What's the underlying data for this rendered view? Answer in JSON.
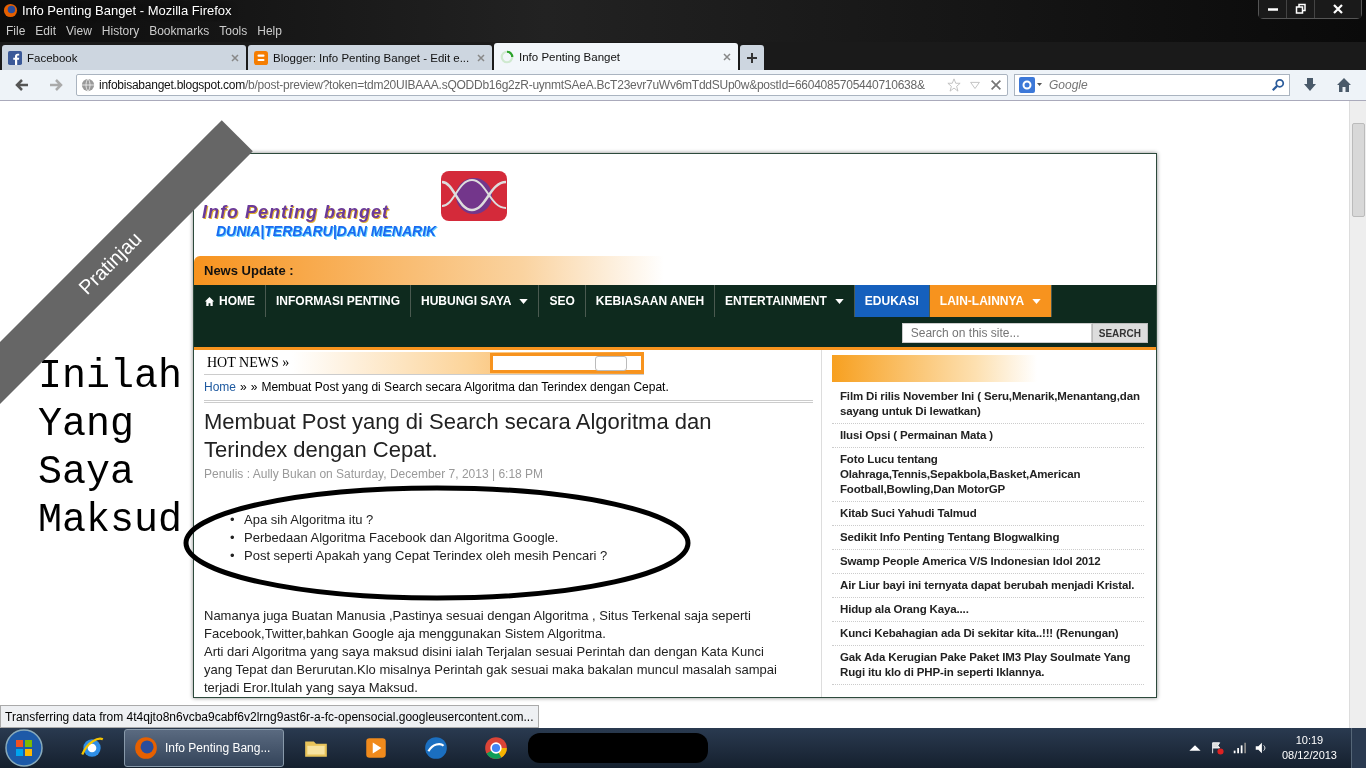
{
  "window": {
    "title": "Info Penting Banget - Mozilla Firefox",
    "menu": [
      "File",
      "Edit",
      "View",
      "History",
      "Bookmarks",
      "Tools",
      "Help"
    ]
  },
  "tabs": [
    {
      "label": "Facebook",
      "kind": "facebook",
      "selected": false
    },
    {
      "label": "Blogger: Info Penting Banget - Edit e...",
      "kind": "blogger",
      "selected": false
    },
    {
      "label": "Info Penting Banget",
      "kind": "loading",
      "selected": true
    }
  ],
  "address": {
    "domain": "infobisabanget.blogspot.com",
    "path": "/b/post-preview?token=tdm20UIBAAA.sQODDb16g2zR-uynmtSAeA.BcT23evr7uWv6mTddSUp0w&postId=6604085705440710638&"
  },
  "search": {
    "placeholder": "Google"
  },
  "preview_ribbon": "Pratinjau",
  "annotation": "Inilah Yang Saya Maksud",
  "blog": {
    "logo_title": "Info Penting banget",
    "logo_subtitle": "DUNIA|TERBARU|DAN MENARIK",
    "news_update": "News Update :",
    "nav": [
      {
        "label": "HOME",
        "kind": "home",
        "dropdown": false,
        "color": "#0e2a1e"
      },
      {
        "label": "INFORMASI PENTING",
        "kind": "link",
        "dropdown": false,
        "color": "#0e2a1e"
      },
      {
        "label": "HUBUNGI SAYA",
        "kind": "link",
        "dropdown": true,
        "color": "#0e2a1e"
      },
      {
        "label": "SEO",
        "kind": "link",
        "dropdown": false,
        "color": "#0e2a1e"
      },
      {
        "label": "KEBIASAAN ANEH",
        "kind": "link",
        "dropdown": false,
        "color": "#0e2a1e"
      },
      {
        "label": "ENTERTAINMENT",
        "kind": "link",
        "dropdown": true,
        "color": "#0e2a1e"
      },
      {
        "label": "EDUKASI",
        "kind": "link",
        "dropdown": false,
        "color": "#1560bd"
      },
      {
        "label": "LAIN-LAINNYA",
        "kind": "link",
        "dropdown": true,
        "color": "#f7931e"
      }
    ],
    "site_search": {
      "placeholder": "Search on this site...",
      "button": "SEARCH"
    },
    "hot_news": "HOT NEWS »",
    "breadcrumb": {
      "home": "Home",
      "separator_1": "»",
      "separator_2": "»",
      "current": "Membuat Post yang di Search secara Algoritma dan Terindex dengan Cepat."
    },
    "post": {
      "title": "Membuat Post yang di Search secara Algoritma dan Terindex dengan Cepat.",
      "meta": "Penulis : Aully Bukan on Saturday, December 7, 2013 | 6:18 PM",
      "bullet_marker": "•",
      "bullets": [
        "Apa sih Algoritma itu ?",
        "Perbedaan Algoritma Facebook dan Algoritma Google.",
        "Post seperti Apakah yang Cepat Terindex oleh mesih Pencari ?"
      ],
      "paragraphs": [
        "Namanya juga Buatan Manusia ,Pastinya sesuai dengan Algoritma , Situs Terkenal saja seperti Facebook,Twitter,bahkan Google aja menggunakan Sistem Algoritma.",
        "Arti dari Algoritma yang saya maksud disini ialah Terjalan sesuai Perintah dan dengan Kata Kunci yang Tepat dan Berurutan.Klo misalnya Perintah gak sesuai maka bakalan muncul masalah sampai terjadi Eror.Itulah yang saya Maksud."
      ]
    },
    "sidebar": [
      "Film Di rilis November Ini ( Seru,Menarik,Menantang,dan sayang untuk Di lewatkan)",
      "Ilusi Opsi ( Permainan Mata )",
      "Foto Lucu tentang Olahraga,Tennis,Sepakbola,Basket,American Football,Bowling,Dan MotorGP",
      "Kitab Suci Yahudi Talmud",
      "Sedikit Info Penting Tentang Blogwalking",
      "Swamp People America V/S Indonesian Idol 2012",
      "Air Liur bayi ini ternyata dapat berubah menjadi Kristal.",
      "Hidup ala Orang Kaya....",
      "Kunci Kebahagian ada Di sekitar kita..!!! (Renungan)",
      "Gak Ada Kerugian Pake Paket IM3 Play Soulmate Yang Rugi itu klo di PHP-in seperti Iklannya."
    ]
  },
  "status_bar": "Transferring data from 4t4qjto8n6vcba9cabf6v2lrng9ast6r-a-fc-opensocial.googleusercontent.com...",
  "taskbar": {
    "items": [
      {
        "kind": "ie",
        "active": false
      },
      {
        "kind": "firefox",
        "label": "Info Penting Bang...",
        "active": true
      },
      {
        "kind": "folder",
        "active": false
      },
      {
        "kind": "media",
        "active": false
      },
      {
        "kind": "bird",
        "active": false
      },
      {
        "kind": "chrome",
        "active": false
      },
      {
        "kind": "redacted",
        "active": false
      }
    ],
    "time": "10:19",
    "date": "08/12/2013"
  }
}
